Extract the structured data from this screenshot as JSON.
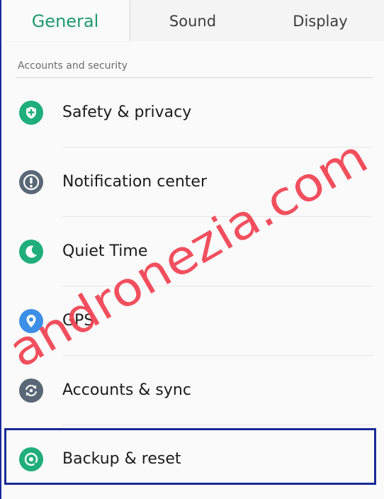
{
  "tabs": [
    {
      "label": "General",
      "active": true
    },
    {
      "label": "Sound",
      "active": false
    },
    {
      "label": "Display",
      "active": false
    }
  ],
  "section": {
    "header": "Accounts and security"
  },
  "items": [
    {
      "label": "Safety & privacy",
      "icon": "shield-plus-icon",
      "color": "#1fae7c"
    },
    {
      "label": "Notification center",
      "icon": "exclamation-icon",
      "color": "#5a6776"
    },
    {
      "label": "Quiet Time",
      "icon": "moon-icon",
      "color": "#1fae7c"
    },
    {
      "label": "GPS",
      "icon": "location-pin-icon",
      "color": "#3d8ee6"
    },
    {
      "label": "Accounts & sync",
      "icon": "sync-icon",
      "color": "#5a6776"
    },
    {
      "label": "Backup & reset",
      "icon": "backup-restore-icon",
      "color": "#1fae7c"
    }
  ],
  "watermark": {
    "text": "andronezia.com",
    "color": "#f04050"
  },
  "colors": {
    "accent": "#1f9a6e",
    "highlight_border": "#1a2a9a"
  }
}
